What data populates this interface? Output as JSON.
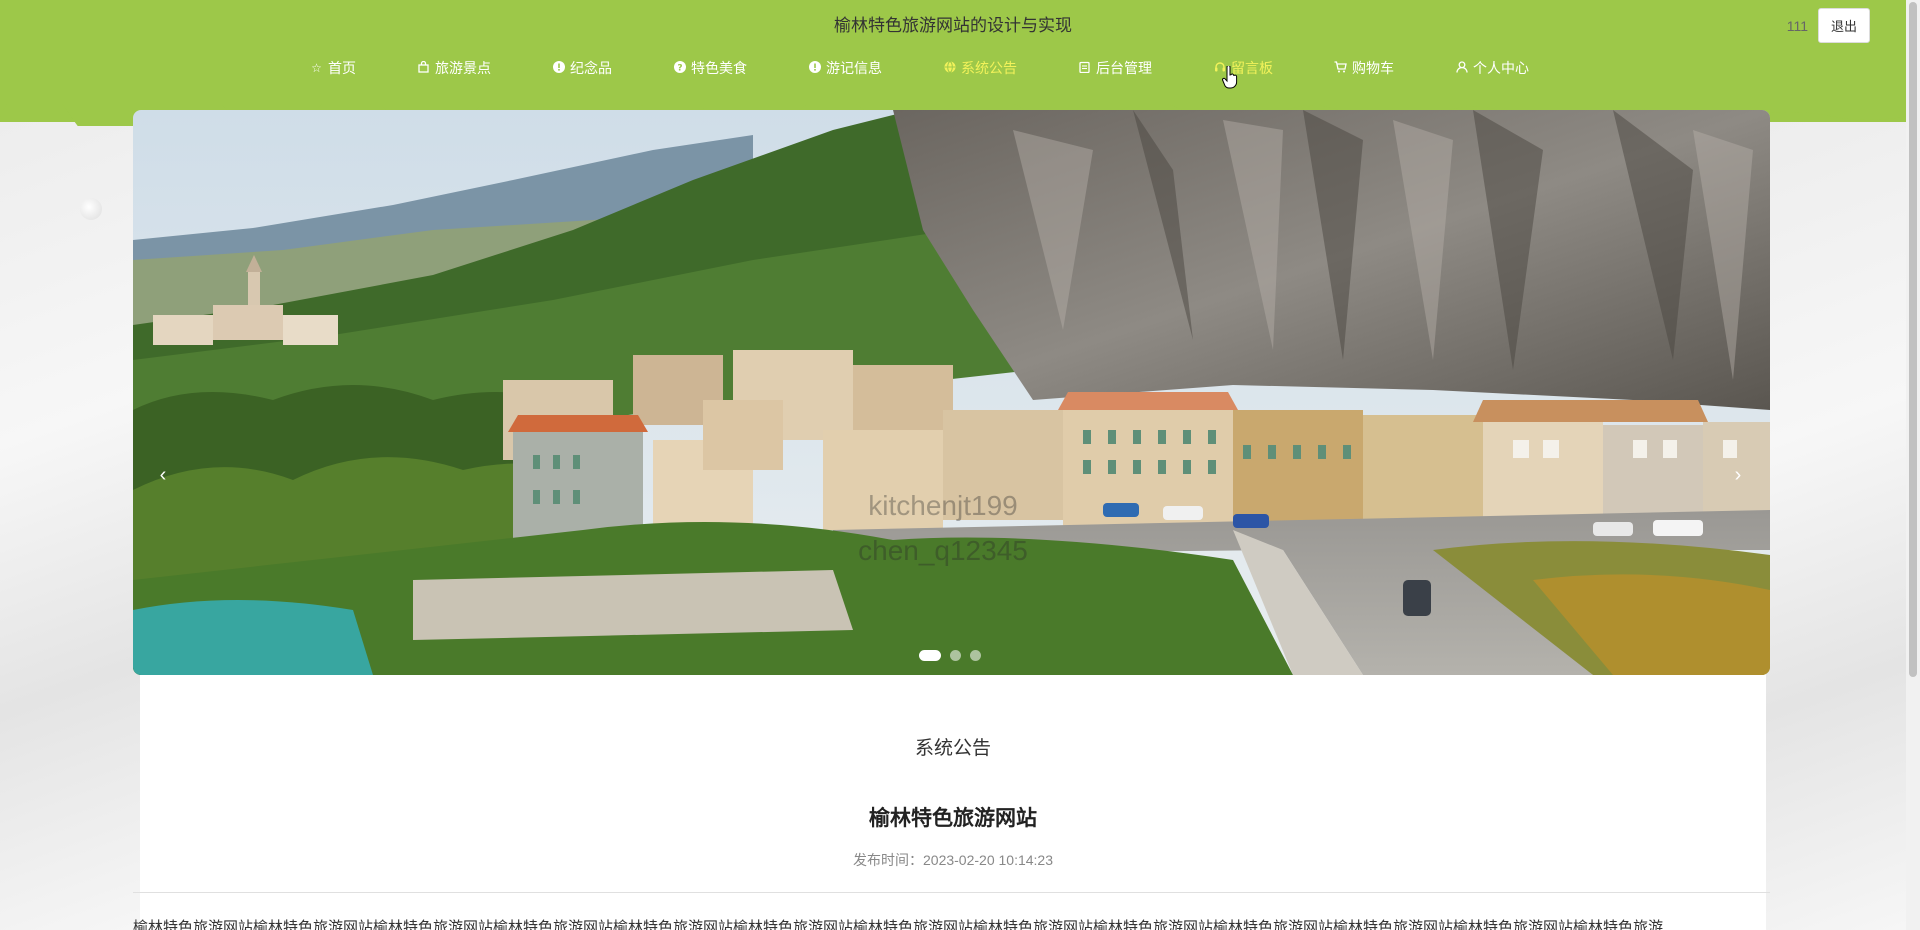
{
  "header": {
    "title": "榆林特色旅游网站的设计与实现",
    "user_name": "111",
    "logout_label": "退出",
    "background_color": "#9dc849",
    "active_color": "#f2f25a"
  },
  "nav": {
    "items": [
      {
        "label": "首页",
        "icon": "star-icon"
      },
      {
        "label": "旅游景点",
        "icon": "bag-icon"
      },
      {
        "label": "纪念品",
        "icon": "info-icon"
      },
      {
        "label": "特色美食",
        "icon": "question-icon"
      },
      {
        "label": "游记信息",
        "icon": "info-icon"
      },
      {
        "label": "系统公告",
        "icon": "globe-icon",
        "active": true
      },
      {
        "label": "后台管理",
        "icon": "clipboard-icon"
      },
      {
        "label": "留言板",
        "icon": "headset-icon"
      },
      {
        "label": "购物车",
        "icon": "cart-icon"
      },
      {
        "label": "个人中心",
        "icon": "user-icon"
      }
    ]
  },
  "carousel": {
    "watermark_line1": "kitchenjt199",
    "watermark_line2": "chen_q12345",
    "slide_count": 3,
    "active_slide": 1
  },
  "notice": {
    "section_title": "系统公告",
    "title": "榆林特色旅游网站",
    "time_label": "发布时间：",
    "time_value": "2023-02-20 10:14:23",
    "body": "榆林特色旅游网站榆林特色旅游网站榆林特色旅游网站榆林特色旅游网站榆林特色旅游网站榆林特色旅游网站榆林特色旅游网站榆林特色旅游网站榆林特色旅游网站榆林特色旅游网站榆林特色旅游网站榆林特色旅游网站榆林特色旅游"
  }
}
